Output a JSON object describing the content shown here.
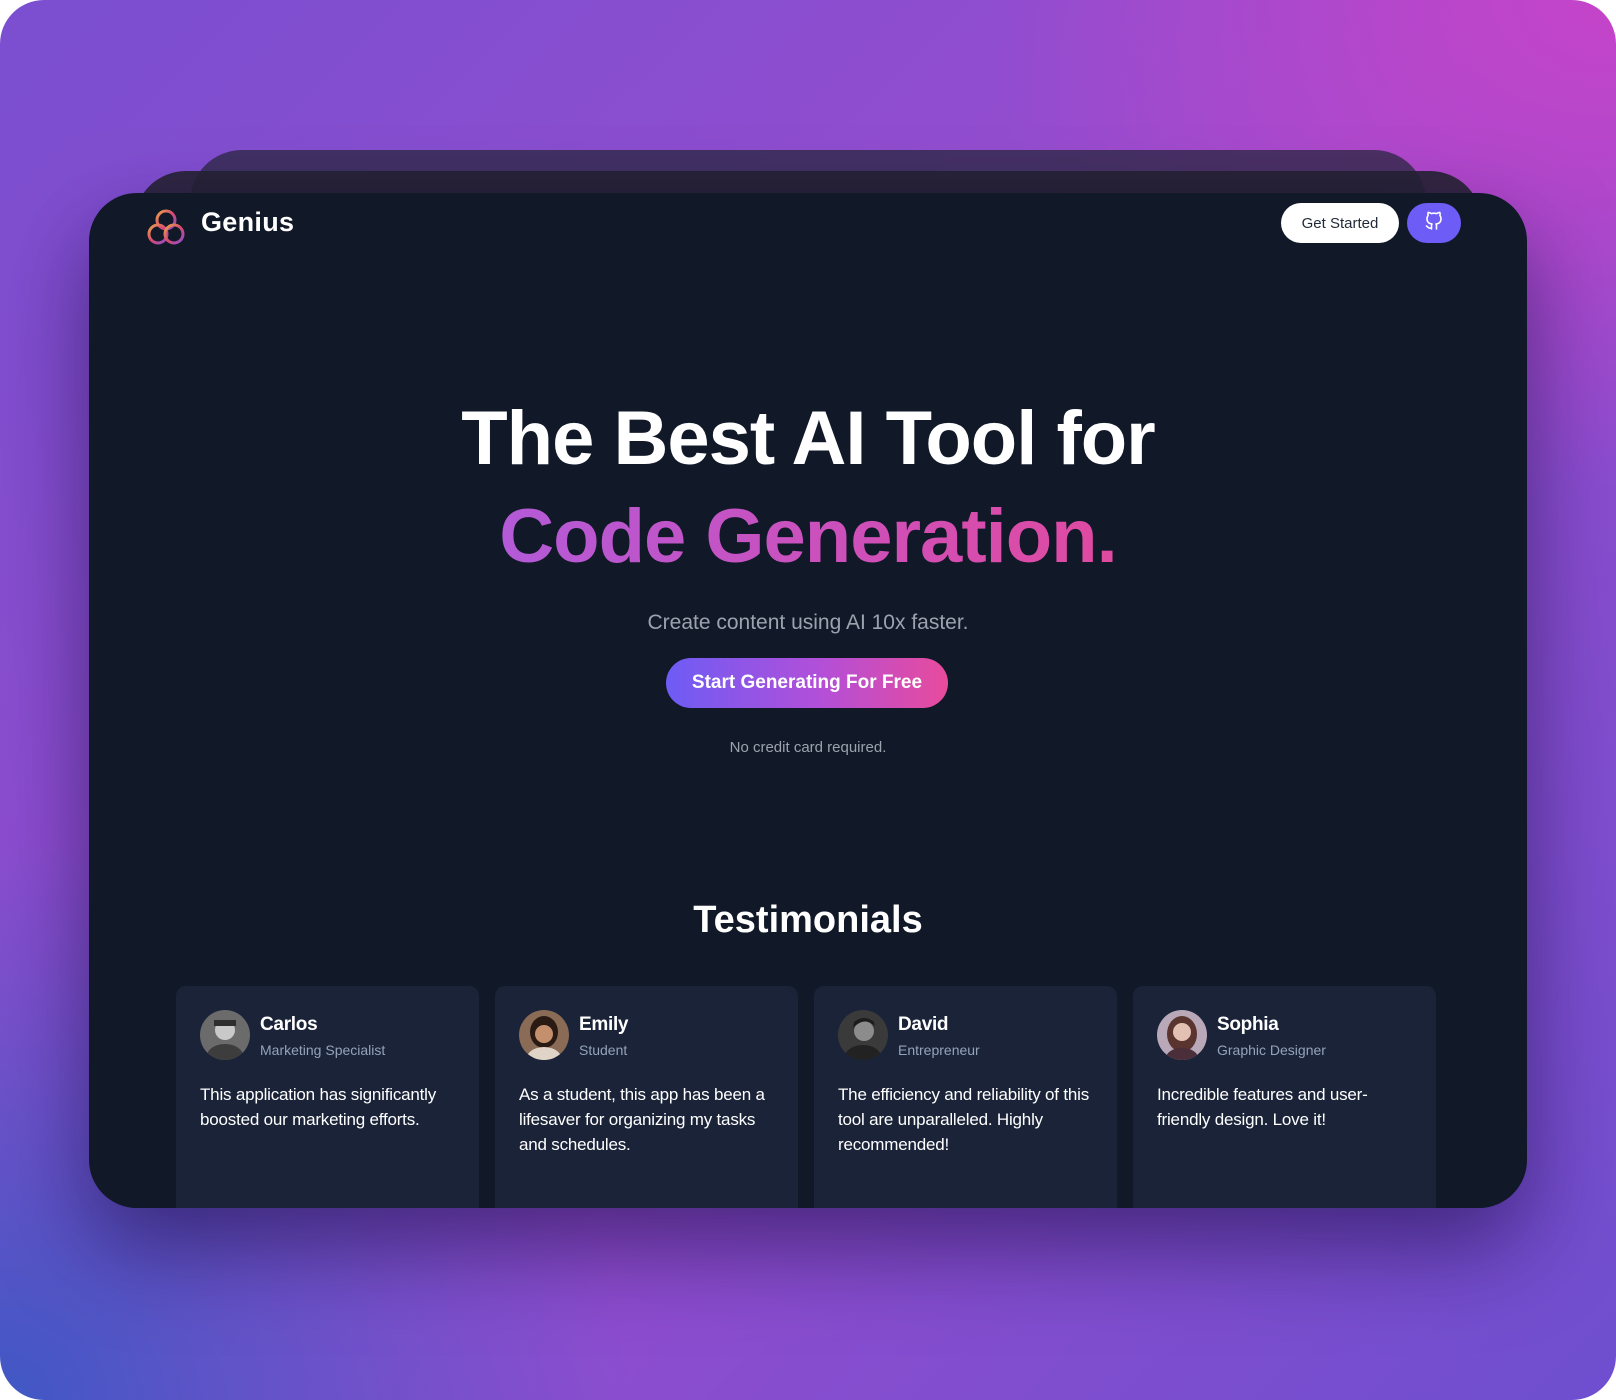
{
  "colors": {
    "accent": "#6d5cf5",
    "gradient_start": "#b35ad8",
    "gradient_end": "#e04aa0",
    "window_bg": "#111827",
    "card_bg": "#1a2338"
  },
  "header": {
    "logo_icon": "genius-logo-icon",
    "brand": "Genius",
    "get_started_label": "Get Started",
    "github_icon": "github-icon"
  },
  "hero": {
    "title_line1": "The Best AI Tool for",
    "title_line2": "Code Generation.",
    "subtitle": "Create content using AI 10x faster.",
    "cta_label": "Start Generating For Free",
    "note": "No credit card required."
  },
  "testimonials": {
    "title": "Testimonials",
    "items": [
      {
        "name": "Carlos",
        "role": "Marketing Specialist",
        "text": "This application has significantly boosted our marketing efforts."
      },
      {
        "name": "Emily",
        "role": "Student",
        "text": "As a student, this app has been a lifesaver for organizing my tasks and schedules."
      },
      {
        "name": "David",
        "role": "Entrepreneur",
        "text": "The efficiency and reliability of this tool are unparalleled. Highly recommended!"
      },
      {
        "name": "Sophia",
        "role": "Graphic Designer",
        "text": "Incredible features and user-friendly design. Love it!"
      }
    ]
  }
}
